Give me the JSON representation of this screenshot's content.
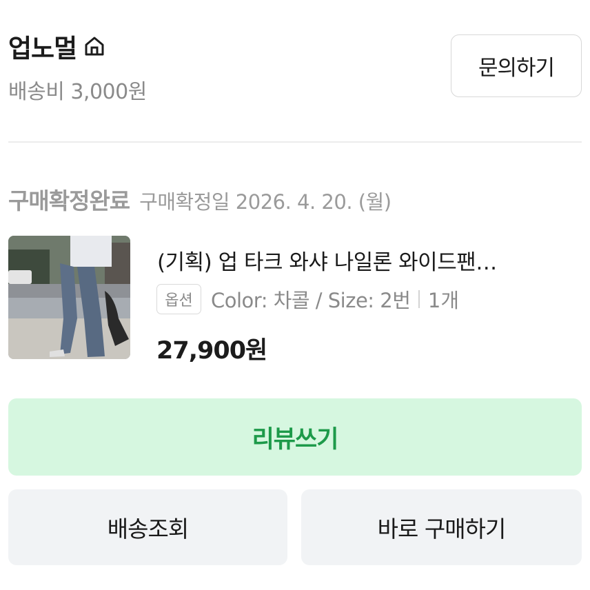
{
  "seller": {
    "name": "업노멀",
    "home_icon": "home-icon",
    "shipping": "배송비 3,000원",
    "inquiry_label": "문의하기"
  },
  "order": {
    "status": "구매확정완료",
    "confirm_date": "구매확정일 2026. 4. 20. (월)"
  },
  "product": {
    "title": "(기획) 업 타크 와샤 나일론 와이드팬…",
    "option_tag": "옵션",
    "option_text": "Color: 차콜 / Size: 2번",
    "quantity": "1개",
    "price": "27,900원"
  },
  "actions": {
    "review": "리뷰쓰기",
    "track": "배송조회",
    "buy_again": "바로 구매하기"
  },
  "colors": {
    "accent_green": "#1d9a4a",
    "review_bg": "#d6f7e0",
    "gray_button_bg": "#f1f3f5"
  }
}
